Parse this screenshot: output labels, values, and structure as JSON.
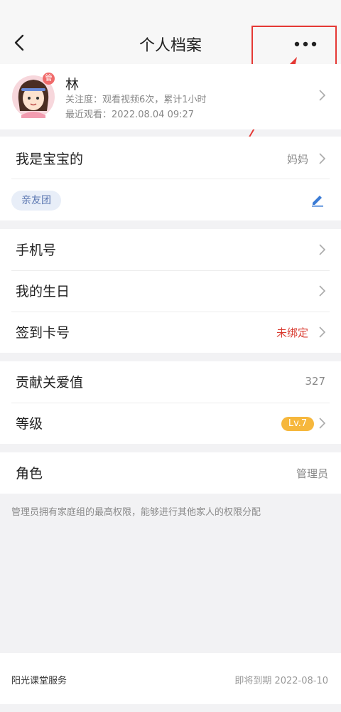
{
  "header": {
    "title": "个人档案",
    "back_icon": "back-chevron-icon",
    "more_icon": "more-dots-icon"
  },
  "profile": {
    "name": "林",
    "avatar_badge": "管",
    "attention": "关注度：观看视频6次，累计1小时",
    "last_watch": "最近观看：2022.08.04 09:27"
  },
  "relation": {
    "label": "我是宝宝的",
    "value": "妈妈",
    "tag": "亲友团",
    "edit_icon": "pencil-icon"
  },
  "info": [
    {
      "label": "手机号",
      "value": ""
    },
    {
      "label": "我的生日",
      "value": ""
    },
    {
      "label": "签到卡号",
      "value": "未绑定"
    }
  ],
  "stats": {
    "love_label": "贡献关爱值",
    "love_value": "327",
    "level_label": "等级",
    "level_value": "Lv.7"
  },
  "role": {
    "label": "角色",
    "value": "管理员",
    "note": "管理员拥有家庭组的最高权限，能够进行其他家人的权限分配"
  },
  "footer": {
    "label": "阳光课堂服务",
    "value": "即将到期 2022-08-10"
  },
  "colors": {
    "accent_red": "#d93a2f",
    "level_badge": "#f6b73c",
    "tag_bg": "#e8eef8",
    "annotation": "#e53935"
  }
}
